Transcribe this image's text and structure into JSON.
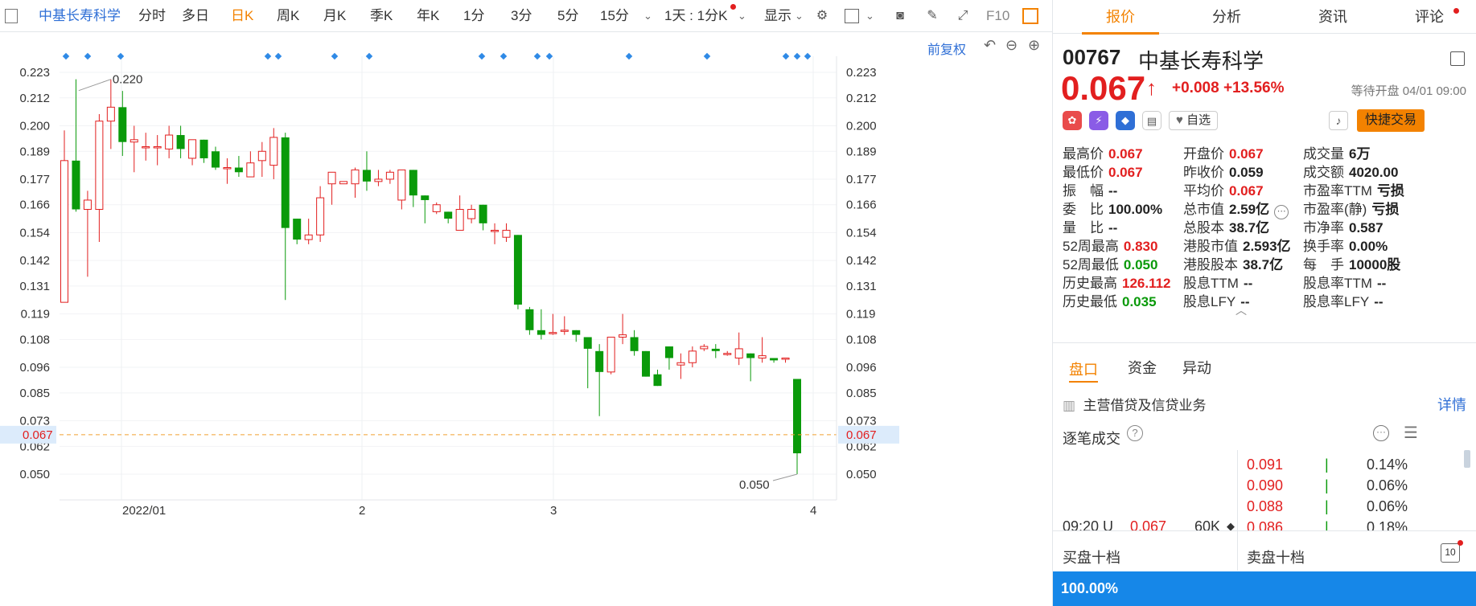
{
  "toolbar": {
    "stock_name": "中基长寿科学",
    "periods": [
      "分时",
      "多日",
      "日K",
      "周K",
      "月K",
      "季K",
      "年K",
      "1分",
      "3分",
      "5分",
      "15分"
    ],
    "active_period": "日K",
    "more_label": "1天 : 1分K",
    "display_label": "显示",
    "f10_label": "F10"
  },
  "chart": {
    "adjust_label": "前复权",
    "high_marker": "0.220",
    "low_marker": "0.050",
    "current_price_tag": "0.067",
    "y_ticks": [
      "0.223",
      "0.212",
      "0.200",
      "0.189",
      "0.177",
      "0.166",
      "0.154",
      "0.142",
      "0.131",
      "0.119",
      "0.108",
      "0.096",
      "0.085",
      "0.073",
      "0.062",
      "0.050"
    ],
    "x_ticks": [
      "2022/01",
      "2",
      "3",
      "4"
    ]
  },
  "chart_data": {
    "type": "candlestick",
    "ylim": [
      0.045,
      0.228
    ],
    "candles": [
      {
        "o": 0.124,
        "h": 0.198,
        "l": 0.124,
        "c": 0.185
      },
      {
        "o": 0.185,
        "h": 0.22,
        "l": 0.163,
        "c": 0.164
      },
      {
        "o": 0.164,
        "h": 0.172,
        "l": 0.135,
        "c": 0.168
      },
      {
        "o": 0.164,
        "h": 0.205,
        "l": 0.15,
        "c": 0.202
      },
      {
        "o": 0.202,
        "h": 0.22,
        "l": 0.19,
        "c": 0.208
      },
      {
        "o": 0.208,
        "h": 0.215,
        "l": 0.187,
        "c": 0.193
      },
      {
        "o": 0.193,
        "h": 0.2,
        "l": 0.18,
        "c": 0.194
      },
      {
        "o": 0.191,
        "h": 0.197,
        "l": 0.185,
        "c": 0.191
      },
      {
        "o": 0.191,
        "h": 0.196,
        "l": 0.183,
        "c": 0.191
      },
      {
        "o": 0.19,
        "h": 0.2,
        "l": 0.186,
        "c": 0.196
      },
      {
        "o": 0.196,
        "h": 0.2,
        "l": 0.186,
        "c": 0.19
      },
      {
        "o": 0.186,
        "h": 0.194,
        "l": 0.183,
        "c": 0.194
      },
      {
        "o": 0.194,
        "h": 0.194,
        "l": 0.184,
        "c": 0.186
      },
      {
        "o": 0.189,
        "h": 0.191,
        "l": 0.181,
        "c": 0.182
      },
      {
        "o": 0.182,
        "h": 0.186,
        "l": 0.175,
        "c": 0.182
      },
      {
        "o": 0.182,
        "h": 0.187,
        "l": 0.178,
        "c": 0.18
      },
      {
        "o": 0.178,
        "h": 0.189,
        "l": 0.178,
        "c": 0.184
      },
      {
        "o": 0.185,
        "h": 0.193,
        "l": 0.178,
        "c": 0.189
      },
      {
        "o": 0.183,
        "h": 0.199,
        "l": 0.177,
        "c": 0.195
      },
      {
        "o": 0.195,
        "h": 0.197,
        "l": 0.125,
        "c": 0.156
      },
      {
        "o": 0.16,
        "h": 0.16,
        "l": 0.149,
        "c": 0.151
      },
      {
        "o": 0.151,
        "h": 0.16,
        "l": 0.149,
        "c": 0.153
      },
      {
        "o": 0.153,
        "h": 0.174,
        "l": 0.15,
        "c": 0.169
      },
      {
        "o": 0.175,
        "h": 0.18,
        "l": 0.166,
        "c": 0.18
      },
      {
        "o": 0.175,
        "h": 0.176,
        "l": 0.175,
        "c": 0.176
      },
      {
        "o": 0.175,
        "h": 0.182,
        "l": 0.169,
        "c": 0.181
      },
      {
        "o": 0.181,
        "h": 0.189,
        "l": 0.172,
        "c": 0.176
      },
      {
        "o": 0.176,
        "h": 0.181,
        "l": 0.174,
        "c": 0.177
      },
      {
        "o": 0.177,
        "h": 0.181,
        "l": 0.175,
        "c": 0.18
      },
      {
        "o": 0.168,
        "h": 0.181,
        "l": 0.164,
        "c": 0.181
      },
      {
        "o": 0.181,
        "h": 0.181,
        "l": 0.165,
        "c": 0.17
      },
      {
        "o": 0.17,
        "h": 0.17,
        "l": 0.158,
        "c": 0.168
      },
      {
        "o": 0.163,
        "h": 0.167,
        "l": 0.162,
        "c": 0.166
      },
      {
        "o": 0.163,
        "h": 0.163,
        "l": 0.158,
        "c": 0.16
      },
      {
        "o": 0.155,
        "h": 0.17,
        "l": 0.155,
        "c": 0.164
      },
      {
        "o": 0.16,
        "h": 0.166,
        "l": 0.158,
        "c": 0.164
      },
      {
        "o": 0.166,
        "h": 0.166,
        "l": 0.155,
        "c": 0.158
      },
      {
        "o": 0.155,
        "h": 0.158,
        "l": 0.149,
        "c": 0.155
      },
      {
        "o": 0.152,
        "h": 0.158,
        "l": 0.15,
        "c": 0.155
      },
      {
        "o": 0.153,
        "h": 0.153,
        "l": 0.121,
        "c": 0.123
      },
      {
        "o": 0.121,
        "h": 0.122,
        "l": 0.11,
        "c": 0.112
      },
      {
        "o": 0.112,
        "h": 0.121,
        "l": 0.108,
        "c": 0.11
      },
      {
        "o": 0.111,
        "h": 0.119,
        "l": 0.11,
        "c": 0.111
      },
      {
        "o": 0.112,
        "h": 0.118,
        "l": 0.11,
        "c": 0.112
      },
      {
        "o": 0.112,
        "h": 0.112,
        "l": 0.107,
        "c": 0.11
      },
      {
        "o": 0.109,
        "h": 0.109,
        "l": 0.087,
        "c": 0.104
      },
      {
        "o": 0.103,
        "h": 0.106,
        "l": 0.075,
        "c": 0.094
      },
      {
        "o": 0.094,
        "h": 0.109,
        "l": 0.093,
        "c": 0.109
      },
      {
        "o": 0.109,
        "h": 0.119,
        "l": 0.106,
        "c": 0.11
      },
      {
        "o": 0.109,
        "h": 0.112,
        "l": 0.101,
        "c": 0.103
      },
      {
        "o": 0.103,
        "h": 0.103,
        "l": 0.092,
        "c": 0.092
      },
      {
        "o": 0.093,
        "h": 0.095,
        "l": 0.088,
        "c": 0.088
      },
      {
        "o": 0.105,
        "h": 0.105,
        "l": 0.095,
        "c": 0.1
      },
      {
        "o": 0.097,
        "h": 0.102,
        "l": 0.091,
        "c": 0.098
      },
      {
        "o": 0.098,
        "h": 0.105,
        "l": 0.096,
        "c": 0.103
      },
      {
        "o": 0.104,
        "h": 0.106,
        "l": 0.103,
        "c": 0.105
      },
      {
        "o": 0.104,
        "h": 0.106,
        "l": 0.1,
        "c": 0.103
      },
      {
        "o": 0.102,
        "h": 0.103,
        "l": 0.101,
        "c": 0.102
      },
      {
        "o": 0.1,
        "h": 0.111,
        "l": 0.097,
        "c": 0.104
      },
      {
        "o": 0.102,
        "h": 0.102,
        "l": 0.09,
        "c": 0.1
      },
      {
        "o": 0.1,
        "h": 0.109,
        "l": 0.098,
        "c": 0.101
      },
      {
        "o": 0.1,
        "h": 0.1,
        "l": 0.098,
        "c": 0.099
      },
      {
        "o": 0.1,
        "h": 0.1,
        "l": 0.098,
        "c": 0.1
      },
      {
        "o": 0.091,
        "h": 0.091,
        "l": 0.05,
        "c": 0.059
      }
    ]
  },
  "quote": {
    "code": "00767",
    "name": "中基长寿科学",
    "price": "0.067",
    "change": "+0.008",
    "change_pct": "+13.56%",
    "status": "等待开盘 04/01 09:00",
    "watch_label": "自选",
    "fast_trade_label": "快捷交易",
    "stats": [
      [
        {
          "k": "最高价",
          "v": "0.067",
          "c": "red"
        },
        {
          "k": "开盘价",
          "v": "0.067",
          "c": "red"
        },
        {
          "k": "成交量",
          "v": "6万",
          "c": "dark"
        }
      ],
      [
        {
          "k": "最低价",
          "v": "0.067",
          "c": "red"
        },
        {
          "k": "昨收价",
          "v": "0.059",
          "c": "dark"
        },
        {
          "k": "成交额",
          "v": "4020.00",
          "c": "dark"
        }
      ],
      [
        {
          "k": "振　幅",
          "v": "--",
          "c": "dark"
        },
        {
          "k": "平均价",
          "v": "0.067",
          "c": "red"
        },
        {
          "k": "市盈率TTM",
          "v": "亏损",
          "c": "dark"
        }
      ],
      [
        {
          "k": "委　比",
          "v": "100.00%",
          "c": "dark"
        },
        {
          "k": "总市值",
          "v": "2.59亿",
          "c": "dark"
        },
        {
          "k": "市盈率(静)",
          "v": "亏损",
          "c": "dark"
        }
      ],
      [
        {
          "k": "量　比",
          "v": "--",
          "c": "dark"
        },
        {
          "k": "总股本",
          "v": "38.7亿",
          "c": "dark"
        },
        {
          "k": "市净率",
          "v": "0.587",
          "c": "dark"
        }
      ],
      [
        {
          "k": "52周最高",
          "v": "0.830",
          "c": "red"
        },
        {
          "k": "港股市值",
          "v": "2.593亿",
          "c": "dark"
        },
        {
          "k": "换手率",
          "v": "0.00%",
          "c": "dark"
        }
      ],
      [
        {
          "k": "52周最低",
          "v": "0.050",
          "c": "green"
        },
        {
          "k": "港股股本",
          "v": "38.7亿",
          "c": "dark"
        },
        {
          "k": "每　手",
          "v": "10000股",
          "c": "dark"
        }
      ],
      [
        {
          "k": "历史最高",
          "v": "126.112",
          "c": "red"
        },
        {
          "k": "股息TTM",
          "v": "--",
          "c": "dark"
        },
        {
          "k": "股息率TTM",
          "v": "--",
          "c": "dark"
        }
      ],
      [
        {
          "k": "历史最低",
          "v": "0.035",
          "c": "green"
        },
        {
          "k": "股息LFY",
          "v": "--",
          "c": "dark"
        },
        {
          "k": "股息率LFY",
          "v": "--",
          "c": "dark"
        }
      ]
    ],
    "sub_tabs": [
      "盘口",
      "资金",
      "异动"
    ],
    "business": "主营借贷及信贷业务",
    "detail_label": "详情",
    "trades_title": "逐笔成交",
    "trade": {
      "time": "09:20 U",
      "price": "0.067",
      "vol": "60K"
    },
    "book": [
      {
        "price": "0.091",
        "pct": "0.14%"
      },
      {
        "price": "0.090",
        "pct": "0.06%"
      },
      {
        "price": "0.088",
        "pct": "0.06%"
      },
      {
        "price": "0.086",
        "pct": "0.18%"
      }
    ],
    "buy_label": "买盘十档",
    "sell_label": "卖盘十档",
    "ratio_label": "100.00%"
  }
}
